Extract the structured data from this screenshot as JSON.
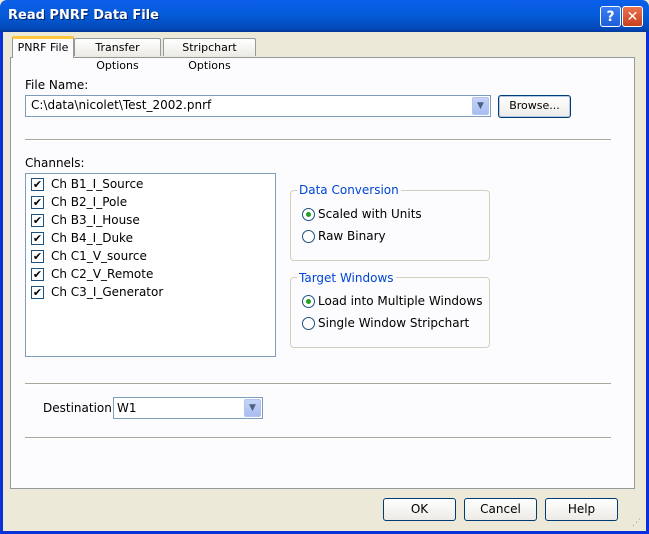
{
  "window": {
    "title": "Read PNRF Data File",
    "help_glyph": "?",
    "close_glyph": "✕"
  },
  "tabs": [
    "PNRF File",
    "Transfer Options",
    "Stripchart Options"
  ],
  "file": {
    "label": "File Name:",
    "value": "C:\\data\\nicolet\\Test_2002.pnrf",
    "browse_label": "Browse..."
  },
  "channels": {
    "label": "Channels:",
    "items": [
      {
        "label": "Ch B1_I_Source",
        "checked": true
      },
      {
        "label": "Ch B2_I_Pole",
        "checked": true
      },
      {
        "label": "Ch B3_I_House",
        "checked": true
      },
      {
        "label": "Ch B4_I_Duke",
        "checked": true
      },
      {
        "label": "Ch C1_V_source",
        "checked": true
      },
      {
        "label": "Ch C2_V_Remote",
        "checked": true
      },
      {
        "label": "Ch C3_I_Generator",
        "checked": true
      }
    ]
  },
  "data_conversion": {
    "title": "Data Conversion",
    "options": [
      "Scaled with Units",
      "Raw Binary"
    ],
    "selected": 0
  },
  "target_windows": {
    "title": "Target Windows",
    "options": [
      "Load into Multiple Windows",
      "Single Window Stripchart"
    ],
    "selected": 0
  },
  "destination": {
    "label": "Destination:",
    "value": "W1"
  },
  "buttons": {
    "ok": "OK",
    "cancel": "Cancel",
    "help": "Help"
  },
  "icons": {
    "dropdown": "chevron-down-icon",
    "check": "✔"
  },
  "colors": {
    "titlebar": "#0a5ee8",
    "group_title": "#0046d5",
    "radio_selected": "#21a121",
    "tab_highlight": "#ffc83c"
  }
}
